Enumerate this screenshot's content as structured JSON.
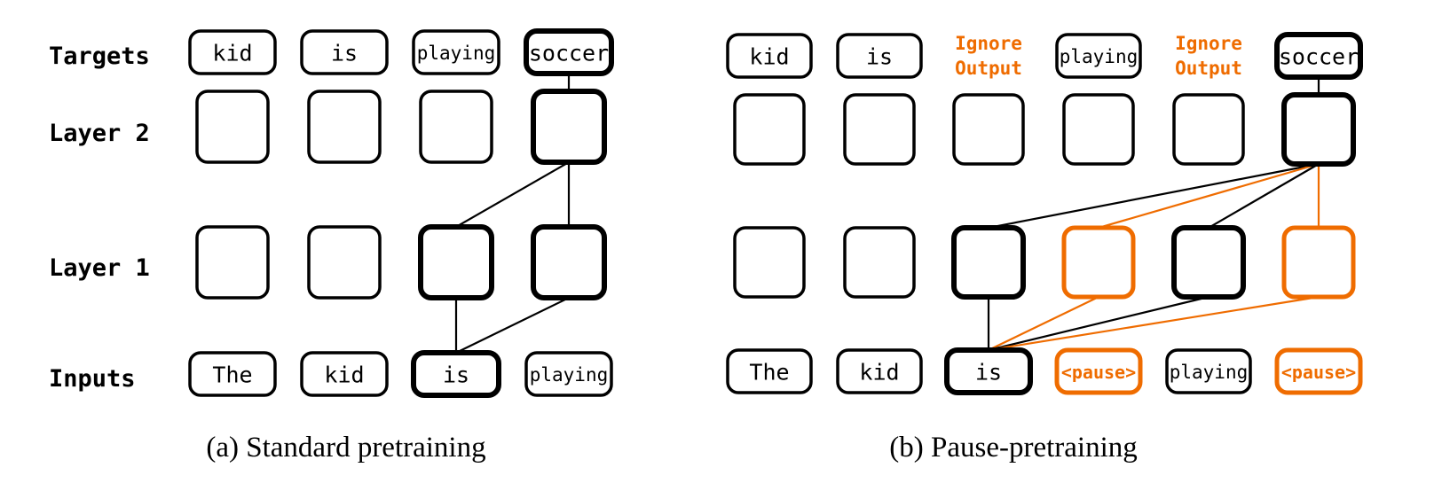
{
  "colors": {
    "ink": "#000000",
    "accent": "#ef6c00",
    "background": "#ffffff"
  },
  "row_labels": {
    "targets": "Targets",
    "layer2": "Layer 2",
    "layer1": "Layer 1",
    "inputs": "Inputs"
  },
  "panel_a": {
    "caption": "(a) Standard pretraining",
    "targets": [
      {
        "text": "kid",
        "highlight": false
      },
      {
        "text": "is",
        "highlight": false
      },
      {
        "text": "playing",
        "highlight": false
      },
      {
        "text": "soccer",
        "highlight": true
      }
    ],
    "layer2": [
      {
        "state": "normal"
      },
      {
        "state": "normal"
      },
      {
        "state": "normal"
      },
      {
        "state": "active"
      }
    ],
    "layer1": [
      {
        "state": "normal"
      },
      {
        "state": "normal"
      },
      {
        "state": "active"
      },
      {
        "state": "active"
      }
    ],
    "inputs": [
      {
        "text": "The",
        "state": "normal"
      },
      {
        "text": "kid",
        "state": "normal"
      },
      {
        "text": "is",
        "state": "active"
      },
      {
        "text": "playing",
        "state": "normal"
      }
    ],
    "edges": [
      {
        "from": "target.3",
        "to": "layer2.3",
        "color": "ink"
      },
      {
        "from": "layer2.3",
        "to": "layer1.2",
        "color": "ink"
      },
      {
        "from": "layer2.3",
        "to": "layer1.3",
        "color": "ink"
      },
      {
        "from": "layer1.2",
        "to": "input.2",
        "color": "ink"
      },
      {
        "from": "layer1.3",
        "to": "input.2",
        "color": "ink"
      }
    ]
  },
  "panel_b": {
    "caption": "(b) Pause-pretraining",
    "targets": [
      {
        "text": "kid",
        "kind": "box",
        "highlight": false
      },
      {
        "text": "is",
        "kind": "box",
        "highlight": false
      },
      {
        "text": "Ignore\nOutput",
        "lines": [
          "Ignore",
          "Output"
        ],
        "kind": "ignore"
      },
      {
        "text": "playing",
        "kind": "box",
        "highlight": false
      },
      {
        "text": "Ignore\nOutput",
        "lines": [
          "Ignore",
          "Output"
        ],
        "kind": "ignore"
      },
      {
        "text": "soccer",
        "kind": "box",
        "highlight": true
      }
    ],
    "layer2": [
      {
        "state": "normal"
      },
      {
        "state": "normal"
      },
      {
        "state": "normal"
      },
      {
        "state": "normal"
      },
      {
        "state": "normal"
      },
      {
        "state": "active"
      }
    ],
    "layer1": [
      {
        "state": "normal"
      },
      {
        "state": "normal"
      },
      {
        "state": "active"
      },
      {
        "state": "pause"
      },
      {
        "state": "active"
      },
      {
        "state": "pause"
      }
    ],
    "inputs": [
      {
        "text": "The",
        "state": "normal"
      },
      {
        "text": "kid",
        "state": "normal"
      },
      {
        "text": "is",
        "state": "active"
      },
      {
        "text": "<pause>",
        "state": "pause"
      },
      {
        "text": "playing",
        "state": "normal"
      },
      {
        "text": "<pause>",
        "state": "pause"
      }
    ],
    "edges": [
      {
        "from": "target.5",
        "to": "layer2.5",
        "color": "ink"
      },
      {
        "from": "layer2.5",
        "to": "layer1.2",
        "color": "ink"
      },
      {
        "from": "layer2.5",
        "to": "layer1.3",
        "color": "accent"
      },
      {
        "from": "layer2.5",
        "to": "layer1.4",
        "color": "ink"
      },
      {
        "from": "layer2.5",
        "to": "layer1.5",
        "color": "accent"
      },
      {
        "from": "layer1.2",
        "to": "input.2",
        "color": "ink"
      },
      {
        "from": "layer1.3",
        "to": "input.2",
        "color": "accent"
      },
      {
        "from": "layer1.4",
        "to": "input.2",
        "color": "ink"
      },
      {
        "from": "layer1.5",
        "to": "input.2",
        "color": "accent"
      }
    ]
  }
}
